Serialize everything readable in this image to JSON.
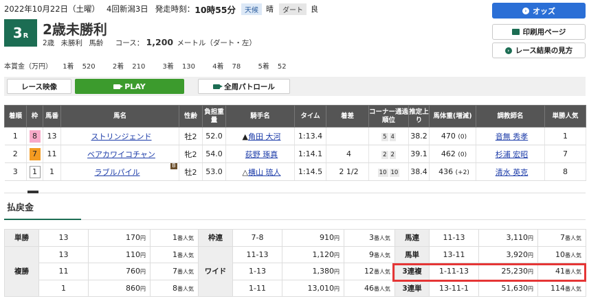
{
  "header": {
    "date": "2022年10月22日（土曜）",
    "meeting": "4回新潟3日",
    "post_time_label": "発走時刻：",
    "post_time": "10時55分",
    "weather_label": "天候",
    "weather": "晴",
    "track_label": "ダート",
    "track_cond": "良"
  },
  "race": {
    "num": "3",
    "num_suffix": "R",
    "name": "2歳未勝利",
    "cond1": "2歳",
    "cond2": "未勝利",
    "cond3": "馬齢",
    "course_label": "コース：",
    "distance": "1,200",
    "distance_unit": "メートル（ダート・左）"
  },
  "prize": {
    "label": "本賞金（万円）",
    "items": [
      {
        "rank": "1着",
        "value": "520"
      },
      {
        "rank": "2着",
        "value": "210"
      },
      {
        "rank": "3着",
        "value": "130"
      },
      {
        "rank": "4着",
        "value": "78"
      },
      {
        "rank": "5着",
        "value": "52"
      }
    ]
  },
  "buttons": {
    "odds": "オッズ",
    "print": "印刷用ページ",
    "howto": "レース結果の見方",
    "video": "レース映像",
    "play": "PLAY",
    "patrol": "全周パトロール"
  },
  "colors": {
    "accent": "#1c6d53",
    "odds_blue": "#2b6fd6",
    "play_green": "#3c9b2d",
    "highlight": "#e53535"
  },
  "results": {
    "headers": [
      "着順",
      "枠",
      "馬番",
      "馬名",
      "性齢",
      "負担重量",
      "騎手名",
      "タイム",
      "着差",
      "コーナー通過順位",
      "推定上り",
      "馬体重(増減)",
      "調教師名",
      "単勝人気"
    ],
    "rows": [
      {
        "rank": "1",
        "waku": "8",
        "num": "13",
        "horse": "ストリンジェンド",
        "sex": "牡2",
        "weight": "52.0",
        "jockey_mark": "▲",
        "jockey": "角田 大河",
        "time": "1:13.4",
        "margin": "",
        "c1": "5",
        "c2": "4",
        "last": "38.2",
        "bw": "470",
        "bwd": "(0)",
        "trainer": "音無 秀孝",
        "pop": "1"
      },
      {
        "rank": "2",
        "waku": "7",
        "num": "11",
        "horse": "ベアカワイコチャン",
        "sex": "牝2",
        "weight": "54.0",
        "jockey_mark": "",
        "jockey": "荻野 琢真",
        "time": "1:14.1",
        "margin": "4",
        "c1": "2",
        "c2": "2",
        "last": "39.1",
        "bw": "462",
        "bwd": "(0)",
        "trainer": "杉浦 宏昭",
        "pop": "7"
      },
      {
        "rank": "3",
        "waku": "1",
        "num": "1",
        "horse": "ラブルパイル",
        "badge": "B",
        "sex": "牡2",
        "weight": "53.0",
        "jockey_mark": "△",
        "jockey": "横山 琉人",
        "time": "1:14.5",
        "margin": "2 1/2",
        "c1": "10",
        "c2": "10",
        "last": "38.4",
        "bw": "436",
        "bwd": "(+2)",
        "trainer": "清水 英克",
        "pop": "8"
      }
    ]
  },
  "payout": {
    "title": "払戻金",
    "yen": "円",
    "pop_suffix": "番人気",
    "tansho": {
      "label": "単勝",
      "rows": [
        {
          "num": "13",
          "amount": "170",
          "pop": "1"
        }
      ]
    },
    "fukusho": {
      "label": "複勝",
      "rows": [
        {
          "num": "13",
          "amount": "110",
          "pop": "1"
        },
        {
          "num": "11",
          "amount": "760",
          "pop": "7"
        },
        {
          "num": "1",
          "amount": "860",
          "pop": "8"
        }
      ]
    },
    "wakuren": {
      "label": "枠連",
      "rows": [
        {
          "num": "7-8",
          "amount": "910",
          "pop": "3"
        }
      ]
    },
    "wide": {
      "label": "ワイド",
      "rows": [
        {
          "num": "11-13",
          "amount": "1,120",
          "pop": "9"
        },
        {
          "num": "1-13",
          "amount": "1,380",
          "pop": "12"
        },
        {
          "num": "1-11",
          "amount": "13,010",
          "pop": "46"
        }
      ]
    },
    "umaren": {
      "label": "馬連",
      "num": "11-13",
      "amount": "3,110",
      "pop": "7"
    },
    "umatan": {
      "label": "馬単",
      "num": "13-11",
      "amount": "3,920",
      "pop": "10"
    },
    "sanrenpuku": {
      "label": "3連複",
      "num": "1-11-13",
      "amount": "25,230",
      "pop": "41"
    },
    "sanrentan": {
      "label": "3連単",
      "num": "13-11-1",
      "amount": "51,630",
      "pop": "114"
    }
  }
}
